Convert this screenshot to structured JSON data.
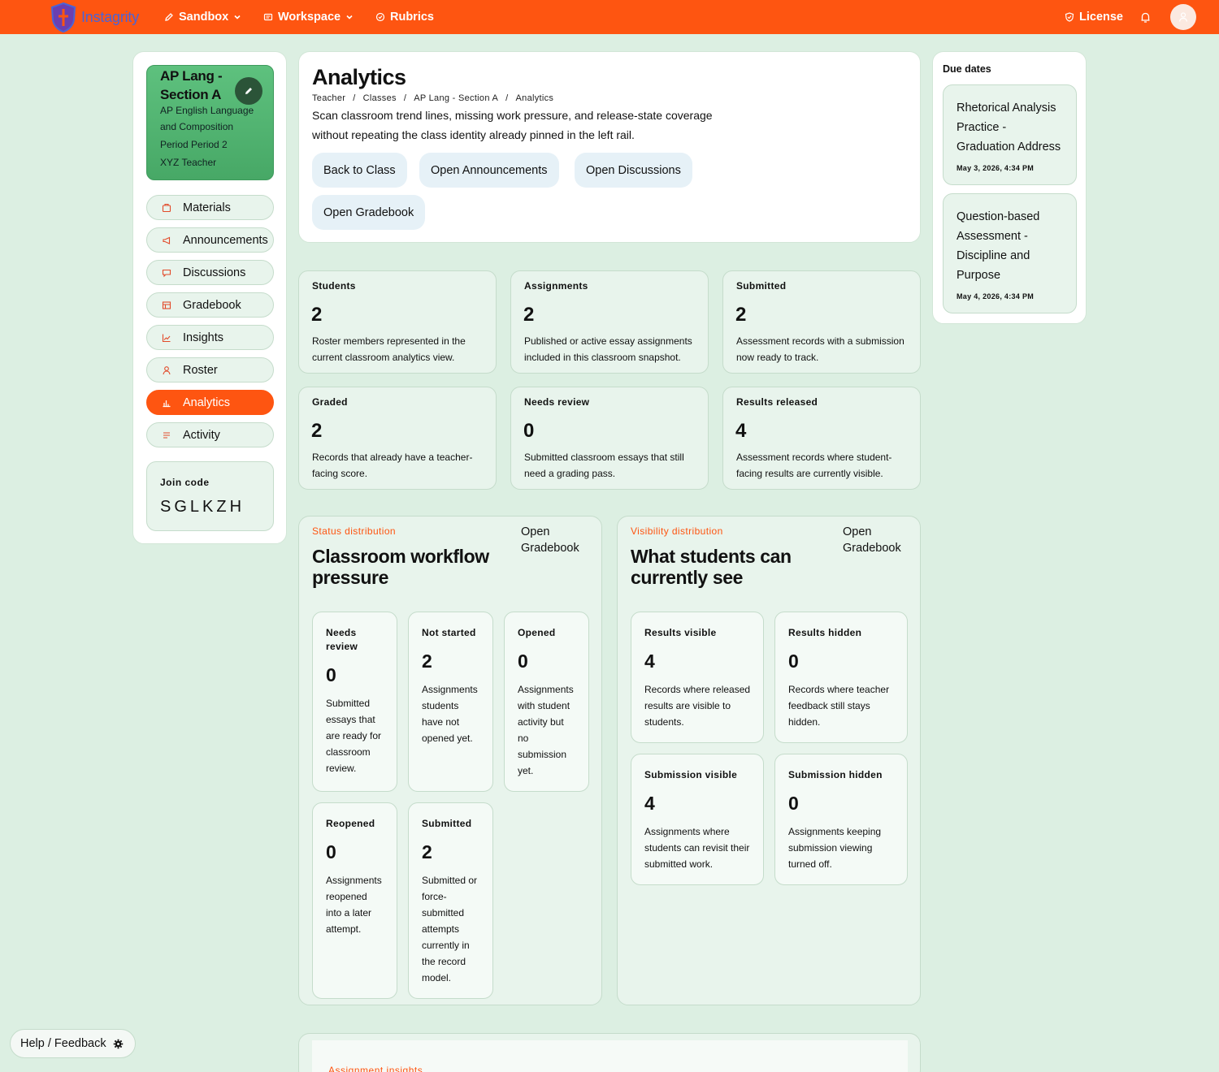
{
  "brand": {
    "name": "Instagrity"
  },
  "nav": {
    "sandbox": "Sandbox",
    "workspace": "Workspace",
    "rubrics": "Rubrics",
    "license": "License"
  },
  "class": {
    "title": "AP Lang - Section A",
    "course": "AP English Language",
    "course2": "and Composition",
    "period": "Period Period 2",
    "teacher": "XYZ Teacher"
  },
  "rail": {
    "items": [
      {
        "label": "Materials",
        "icon": "materials-icon"
      },
      {
        "label": "Announcements",
        "icon": "megaphone-icon"
      },
      {
        "label": "Discussions",
        "icon": "chat-icon"
      },
      {
        "label": "Gradebook",
        "icon": "table-icon"
      },
      {
        "label": "Insights",
        "icon": "line-chart-icon"
      },
      {
        "label": "Roster",
        "icon": "person-icon"
      },
      {
        "label": "Analytics",
        "icon": "bar-chart-icon",
        "active": true
      },
      {
        "label": "Activity",
        "icon": "list-icon"
      }
    ],
    "join_label": "Join code",
    "join_code": "SGLKZH"
  },
  "header": {
    "title": "Analytics",
    "breadcrumbs": [
      "Teacher",
      "Classes",
      "AP Lang - Section A",
      "Analytics"
    ],
    "desc1": "Scan classroom trend lines, missing work pressure, and release-state coverage",
    "desc2": "without repeating the class identity already pinned in the left rail.",
    "buttons": [
      "Back to Class",
      "Open Announcements",
      "Open Discussions",
      "Open Gradebook"
    ]
  },
  "stats": [
    {
      "label": "Students",
      "value": "2",
      "d1": "Roster members represented in the",
      "d2": "current classroom analytics view."
    },
    {
      "label": "Assignments",
      "value": "2",
      "d1": "Published or active essay assignments",
      "d2": "included in this classroom snapshot."
    },
    {
      "label": "Submitted",
      "value": "2",
      "d1": "Assessment records with a submission",
      "d2": "now ready to track."
    },
    {
      "label": "Graded",
      "value": "2",
      "d1": "Records that already have a teacher-",
      "d2": "facing score."
    },
    {
      "label": "Needs review",
      "value": "0",
      "d1": "Submitted classroom essays that still",
      "d2": "need a grading pass."
    },
    {
      "label": "Results released",
      "value": "4",
      "d1": "Assessment records where student-",
      "d2": "facing results are currently visible."
    }
  ],
  "status_panel": {
    "eyebrow": "Status distribution",
    "title": "Classroom workflow pressure",
    "link1": "Open",
    "link2": "Gradebook",
    "cards": [
      {
        "l1": "Needs",
        "l2": "review",
        "value": "0",
        "lines": [
          "Submitted",
          "essays that",
          "are ready for",
          "classroom",
          "review."
        ]
      },
      {
        "l1": "Not started",
        "l2": "",
        "value": "2",
        "lines": [
          "Assignments",
          "students",
          "have not",
          "opened yet."
        ]
      },
      {
        "l1": "Opened",
        "l2": "",
        "value": "0",
        "lines": [
          "Assignments",
          "with student",
          "activity but",
          "no",
          "submission",
          "yet."
        ]
      },
      {
        "l1": "Reopened",
        "l2": "",
        "value": "0",
        "lines": [
          "Assignments",
          "reopened",
          "into a later",
          "attempt."
        ]
      },
      {
        "l1": "Submitted",
        "l2": "",
        "value": "2",
        "lines": [
          "Submitted or",
          "force-",
          "submitted",
          "attempts",
          "currently in",
          "the record",
          "model."
        ]
      }
    ]
  },
  "visibility_panel": {
    "eyebrow": "Visibility distribution",
    "title": "What students can currently see",
    "link1": "Open",
    "link2": "Gradebook",
    "cards": [
      {
        "l1": "Results visible",
        "value": "4",
        "lines": [
          "Records where released",
          "results are visible to",
          "students."
        ]
      },
      {
        "l1": "Results hidden",
        "value": "0",
        "lines": [
          "Records where teacher",
          "feedback still stays",
          "hidden."
        ]
      },
      {
        "l1": "Submission visible",
        "value": "4",
        "lines": [
          "Assignments where",
          "students can revisit their",
          "submitted work."
        ]
      },
      {
        "l1": "Submission hidden",
        "value": "0",
        "lines": [
          "Assignments keeping",
          "submission viewing",
          "turned off."
        ]
      }
    ]
  },
  "due": {
    "heading": "Due dates",
    "items": [
      {
        "lines": [
          "Rhetorical Analysis",
          "Practice -",
          "Graduation Address"
        ],
        "date": "May 3, 2026, 4:34 PM"
      },
      {
        "lines": [
          "Question-based",
          "Assessment -",
          "Discipline and",
          "Purpose"
        ],
        "date": "May 4, 2026, 4:34 PM"
      }
    ]
  },
  "insights": {
    "label": "Assignment insights"
  },
  "help": {
    "label": "Help / Feedback"
  },
  "colors": {
    "accent": "#fe5511",
    "card": "#e8f4ec",
    "background": "#dcefe2",
    "class_card": "#4fb06d"
  }
}
